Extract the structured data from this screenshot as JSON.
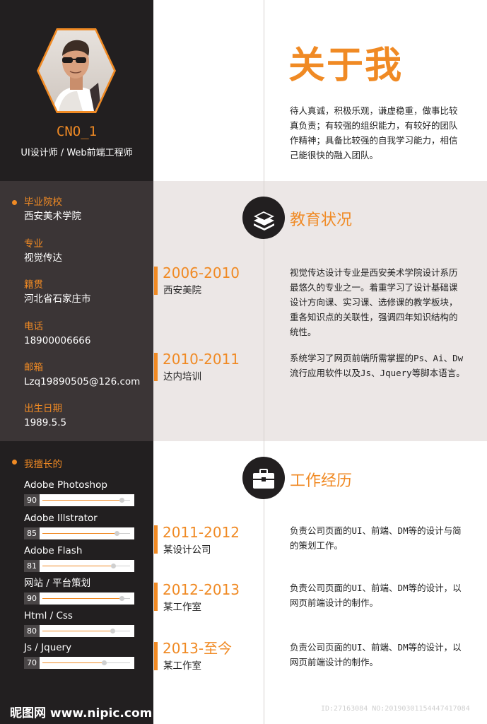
{
  "profile": {
    "name": "CNO_1",
    "role": "UI设计师 / Web前端工程师"
  },
  "info": [
    {
      "label": "毕业院校",
      "value": "西安美术学院"
    },
    {
      "label": "专业",
      "value": "视觉传达"
    },
    {
      "label": "籍贯",
      "value": "河北省石家庄市"
    },
    {
      "label": "电话",
      "value": "18900006666"
    },
    {
      "label": "邮箱",
      "value": "Lzq19890505@126.com"
    },
    {
      "label": "出生日期",
      "value": "1989.5.5"
    }
  ],
  "skills": {
    "title": "我擅长的",
    "items": [
      {
        "name": "Adobe Photoshop",
        "level": 90
      },
      {
        "name": "Adobe Illstrator",
        "level": 85
      },
      {
        "name": "Adobe Flash",
        "level": 81
      },
      {
        "name": "网站 / 平台策划",
        "level": 90
      },
      {
        "name": "Html / Css",
        "level": 80
      },
      {
        "name": "Js / Jquery",
        "level": 70
      }
    ]
  },
  "about": {
    "title": "关于我",
    "text": "待人真诚，积极乐观，谦虚稳重，做事比较\n真负责；有较强的组织能力，有较好的团队\n作精神；具备比较强的自我学习能力，相信\n己能很快的融入团队。"
  },
  "education": {
    "title": "教育状况",
    "icon": "books-icon",
    "entries": [
      {
        "years": "2006-2010",
        "place": "西安美院",
        "text": "视觉传达设计专业是西安美术学院设计系历\n最悠久的专业之一。着重学习了设计基础课\n设计方向课、实习课、选修课的教学板块，\n重各知识点的关联性，强调四年知识结构的\n统性。"
      },
      {
        "years": "2010-2011",
        "place": "达内培训",
        "text": "系统学习了网页前端所需掌握的Ps、Ai、Dw\n流行应用软件以及Js、Jquery等脚本语言。"
      }
    ]
  },
  "work": {
    "title": "工作经历",
    "icon": "briefcase-icon",
    "entries": [
      {
        "years": "2011-2012",
        "place": "某设计公司",
        "text": "负责公司页面的UI、前端、DM等的设计与简\n的策划工作。"
      },
      {
        "years": "2012-2013",
        "place": "某工作室",
        "text": "负责公司页面的UI、前端、DM等的设计，以\n网页前端设计的制作。"
      },
      {
        "years": "2013-至今",
        "place": "某工作室",
        "text": "负责公司页面的UI、前端、DM等的设计，以\n网页前端设计的制作。"
      }
    ]
  },
  "watermark": {
    "left": "昵图网 www.nipic.com",
    "right": "ID:27163084 NO:20190301154447417084"
  },
  "colors": {
    "accent": "#f08a24",
    "sidebar": "#221f20",
    "band": "#ece7e6"
  }
}
